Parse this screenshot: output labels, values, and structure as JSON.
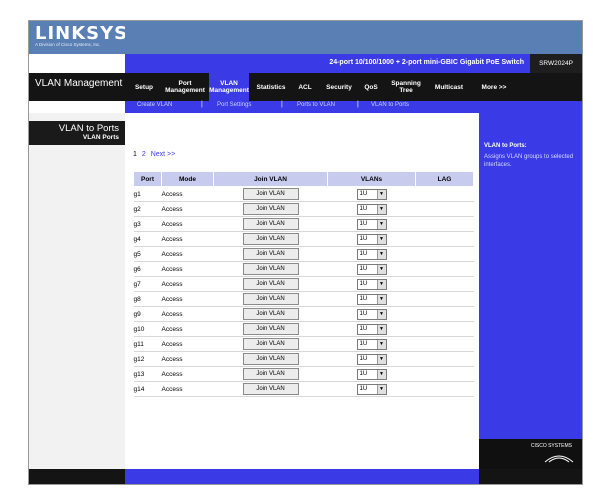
{
  "brand": {
    "logo": "LINKSYS",
    "tagline": "A Division of Cisco Systems, Inc."
  },
  "header": {
    "product": "24-port 10/100/1000 + 2-port mini-GBIC Gigabit PoE Switch",
    "model": "SRW2024P"
  },
  "section_title": "VLAN Management",
  "nav": {
    "setup": "Setup",
    "port_management": "Port Management",
    "vlan_management": "VLAN Management",
    "statistics": "Statistics",
    "acl": "ACL",
    "security": "Security",
    "qos": "QoS",
    "spanning_tree": "Spanning Tree",
    "multicast": "Multicast",
    "more": "More >>"
  },
  "subnav": {
    "create_vlan": "Create VLAN",
    "port_settings": "Port Settings",
    "ports_to_vlan": "Ports to VLAN",
    "vlan_to_ports": "VLAN to Ports"
  },
  "sidebar": {
    "title": "VLAN to Ports",
    "item": "VLAN Ports"
  },
  "pager": {
    "page1": "1",
    "page2": "2",
    "next": "Next >>"
  },
  "table": {
    "headers": {
      "port": "Port",
      "mode": "Mode",
      "join": "Join VLAN",
      "vlans": "VLANs",
      "lag": "LAG"
    },
    "button_label": "Join VLAN",
    "rows": [
      {
        "port": "g1",
        "mode": "Access",
        "vlan": "1U"
      },
      {
        "port": "g2",
        "mode": "Access",
        "vlan": "1U"
      },
      {
        "port": "g3",
        "mode": "Access",
        "vlan": "1U"
      },
      {
        "port": "g4",
        "mode": "Access",
        "vlan": "1U"
      },
      {
        "port": "g5",
        "mode": "Access",
        "vlan": "1U"
      },
      {
        "port": "g6",
        "mode": "Access",
        "vlan": "1U"
      },
      {
        "port": "g7",
        "mode": "Access",
        "vlan": "1U"
      },
      {
        "port": "g8",
        "mode": "Access",
        "vlan": "1U"
      },
      {
        "port": "g9",
        "mode": "Access",
        "vlan": "1U"
      },
      {
        "port": "g10",
        "mode": "Access",
        "vlan": "1U"
      },
      {
        "port": "g11",
        "mode": "Access",
        "vlan": "1U"
      },
      {
        "port": "g12",
        "mode": "Access",
        "vlan": "1U"
      },
      {
        "port": "g13",
        "mode": "Access",
        "vlan": "1U"
      },
      {
        "port": "g14",
        "mode": "Access",
        "vlan": "1U"
      }
    ]
  },
  "help": {
    "title": "VLAN to Ports:",
    "text": "Assigns VLAN groups to selected interfaces."
  },
  "footer": {
    "cisco": "CISCO SYSTEMS"
  },
  "colors": {
    "brand_blue": "#5a7fb5",
    "accent_blue": "#3a3ae6",
    "dark": "#141414",
    "header_row": "#c7ccee"
  }
}
